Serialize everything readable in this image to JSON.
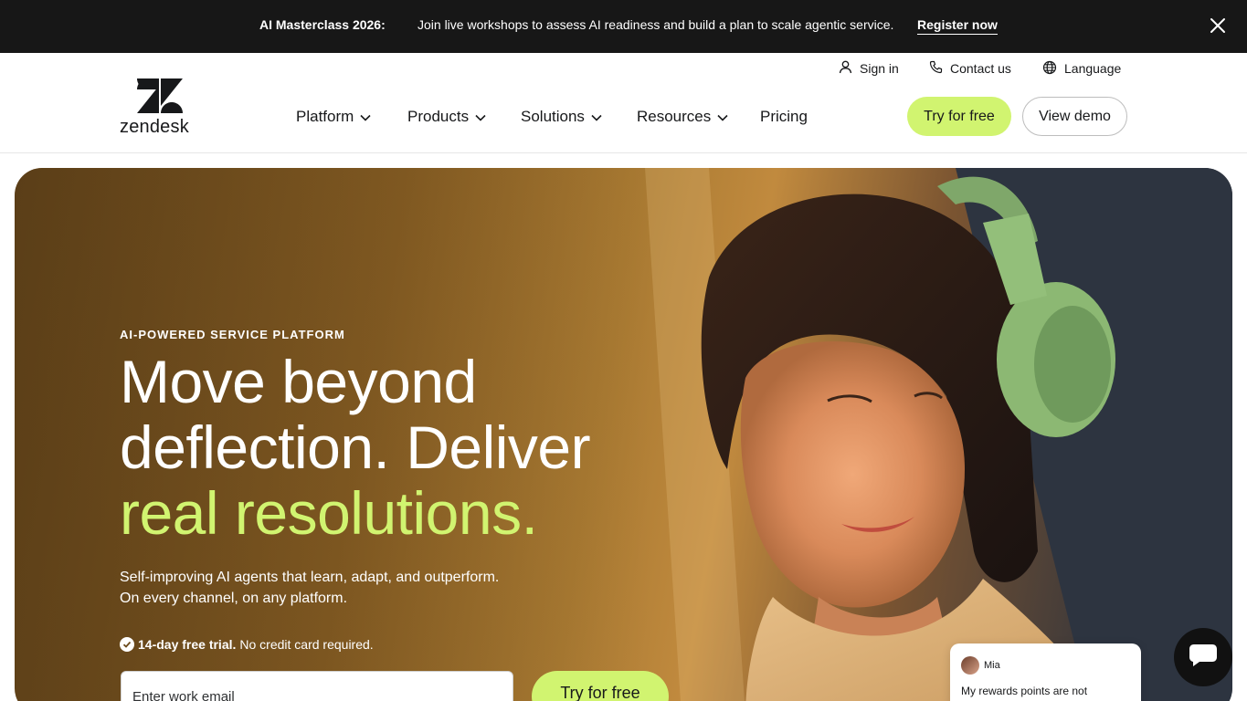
{
  "announcement": {
    "title": "AI Masterclass 2026:",
    "text": "Join live workshops to assess AI readiness and build a plan to scale agentic service.",
    "link": "Register now",
    "close_icon": "close-icon"
  },
  "header": {
    "logo_text": "zendesk",
    "utility": {
      "sign_in": "Sign in",
      "contact": "Contact us",
      "language": "Language"
    },
    "nav": {
      "platform": "Platform",
      "products": "Products",
      "solutions": "Solutions",
      "resources": "Resources",
      "pricing": "Pricing"
    },
    "try_free": "Try for free",
    "view_demo": "View demo"
  },
  "hero": {
    "eyebrow": "AI-POWERED SERVICE PLATFORM",
    "headline_line1": "Move beyond",
    "headline_line2": "deflection. Deliver",
    "headline_accent": "real resolutions.",
    "subcopy_line1": "Self-improving AI agents that learn, adapt, and outperform.",
    "subcopy_line2": "On every channel, on any platform.",
    "trial_bold": "14-day free trial.",
    "trial_text": "No credit card required.",
    "email_placeholder": "Enter work email",
    "try_free": "Try for free",
    "chat_name": "Mia",
    "chat_message": "My rewards points are not"
  },
  "colors": {
    "accent": "#d1f470",
    "announcement_bg": "#171717",
    "text": "#17181a"
  }
}
